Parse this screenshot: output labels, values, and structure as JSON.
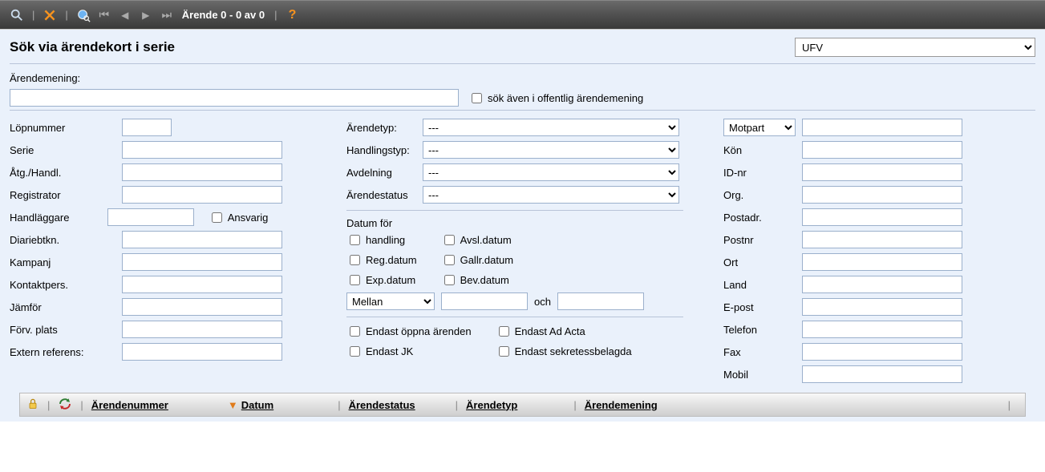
{
  "toolbar": {
    "record_label": "Ärende 0 - 0 av 0"
  },
  "title": "Sök via ärendekort i serie",
  "series_select": "UFV",
  "subject": {
    "label": "Ärendemening:",
    "value": "",
    "also_public_label": "sök även i offentlig ärendemening"
  },
  "left": {
    "lopnummer": "Löpnummer",
    "serie": "Serie",
    "atg": "Åtg./Handl.",
    "registrator": "Registrator",
    "handlaggare": "Handläggare",
    "ansvarig": "Ansvarig",
    "diariebtkn": "Diariebtkn.",
    "kampanj": "Kampanj",
    "kontaktpers": "Kontaktpers.",
    "jamfor": "Jämför",
    "forvplats": "Förv. plats",
    "externref": "Extern referens:"
  },
  "mid": {
    "arendetyp": "Ärendetyp:",
    "handlingstyp": "Handlingstyp:",
    "avdelning": "Avdelning",
    "arendestatus": "Ärendestatus",
    "placeholder": "---",
    "datum_for": "Datum för",
    "handling": "handling",
    "regdatum": "Reg.datum",
    "expdatum": "Exp.datum",
    "avsldatum": "Avsl.datum",
    "gallrdatum": "Gallr.datum",
    "bevdatum": "Bev.datum",
    "mellan": "Mellan",
    "och": "och",
    "oppna": "Endast öppna ärenden",
    "adacta": "Endast Ad Acta",
    "jk": "Endast JK",
    "sekretess": "Endast sekretessbelagda"
  },
  "right": {
    "motpart": "Motpart",
    "kon": "Kön",
    "idnr": "ID-nr",
    "org": "Org.",
    "postadr": "Postadr.",
    "postnr": "Postnr",
    "ort": "Ort",
    "land": "Land",
    "epost": "E-post",
    "telefon": "Telefon",
    "fax": "Fax",
    "mobil": "Mobil"
  },
  "table": {
    "arendenummer": "Ärendenummer",
    "datum": "Datum",
    "arendestatus": "Ärendestatus",
    "arendetyp": "Ärendetyp",
    "arendemening": "Ärendemening"
  }
}
